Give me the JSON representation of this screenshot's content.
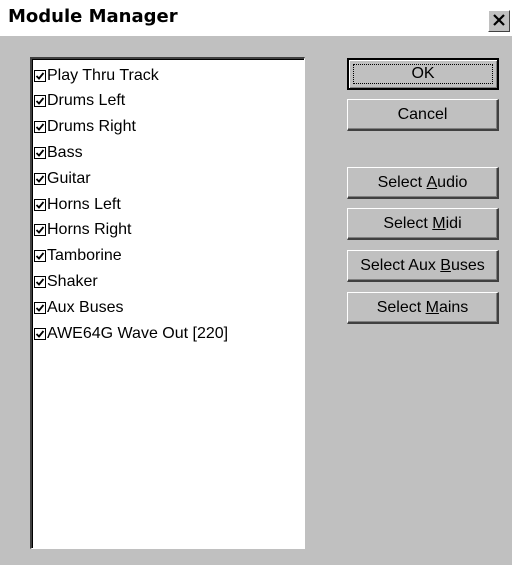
{
  "window": {
    "title": "Module Manager",
    "close_glyph": "✕"
  },
  "modules": {
    "items": [
      {
        "label": "Play Thru Track",
        "checked": true
      },
      {
        "label": "Drums Left",
        "checked": true
      },
      {
        "label": "Drums Right",
        "checked": true
      },
      {
        "label": "Bass",
        "checked": true
      },
      {
        "label": "Guitar",
        "checked": true
      },
      {
        "label": "Horns Left",
        "checked": true
      },
      {
        "label": "Horns Right",
        "checked": true
      },
      {
        "label": "Tamborine",
        "checked": true
      },
      {
        "label": "Shaker",
        "checked": true
      },
      {
        "label": "Aux Buses",
        "checked": true
      },
      {
        "label": "AWE64G Wave Out [220]",
        "checked": true
      }
    ]
  },
  "buttons": {
    "ok": "OK",
    "cancel": "Cancel",
    "select_audio": {
      "pre": "Select ",
      "hotkey": "A",
      "post": "udio"
    },
    "select_midi": {
      "pre": "Select ",
      "hotkey": "M",
      "post": "idi"
    },
    "select_aux_buses": {
      "pre": "Select Aux ",
      "hotkey": "B",
      "post": "uses"
    },
    "select_mains": {
      "pre": "Select ",
      "hotkey": "M",
      "post": "ains"
    }
  },
  "colors": {
    "face": "#c0c0c0",
    "shadow": "#404040",
    "highlight": "#ffffff",
    "text": "#000000"
  },
  "icons": {
    "checkbox": "checkmark-icon",
    "close": "close-icon"
  }
}
